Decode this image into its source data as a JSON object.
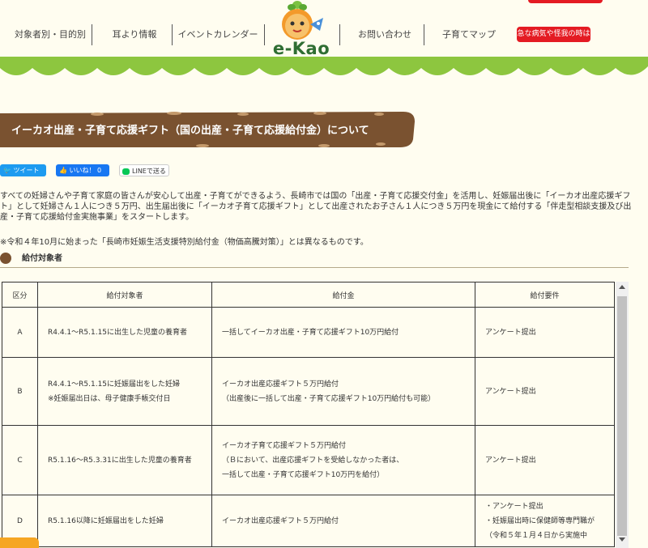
{
  "nav": {
    "items": [
      "対象者別・目的別",
      "耳より情報",
      "イベントカレンダー",
      "お問い合わせ",
      "子育てマップ"
    ],
    "emergency": "急な病気や怪我の時は"
  },
  "logo": {
    "text": "e-Kao"
  },
  "page": {
    "title": "イーカオ出産・子育て応援ギフト（国の出産・子育て応援給付金）について"
  },
  "share": {
    "tweet": "ツイート",
    "like": "いいね！ 0",
    "line": "LINEで送る"
  },
  "intro": "すべての妊婦さんや子育て家庭の皆さんが安心して出産・子育てができるよう、長崎市では国の「出産・子育て応援交付金」を活用し、妊娠届出後に「イーカオ出産応援ギフト」として妊婦さん１人につき５万円、出生届出後に「イーカオ子育て応援ギフト」として出産されたお子さん１人につき５万円を現金にて給付する「伴走型相談支援及び出産・子育て応援給付金実施事業」をスタートします。",
  "note": "※令和４年10月に始まった「長崎市妊娠生活支援特別給付金（物価高騰対策）」とは異なるものです。",
  "section": {
    "title": "給付対象者"
  },
  "table": {
    "headers": [
      "区分",
      "給付対象者",
      "給付金",
      "給付要件"
    ],
    "rows": [
      {
        "key": "A",
        "target": [
          "R4.4.1～R5.1.15に出生した児童の養育者"
        ],
        "amount": [
          "一括してイーカオ出産・子育て応援ギフト10万円給付"
        ],
        "req": [
          "アンケート提出"
        ]
      },
      {
        "key": "B",
        "target": [
          "R4.4.1～R5.1.15に妊娠届出をした妊婦",
          "※妊娠届出日は、母子健康手帳交付日"
        ],
        "amount": [
          "イーカオ出産応援ギフト５万円給付",
          "（出産後に一括して出産・子育て応援ギフト10万円給付も可能）"
        ],
        "req": [
          "アンケート提出"
        ]
      },
      {
        "key": "C",
        "target": [
          "R5.1.16～R5.3.31に出生した児童の養育者"
        ],
        "amount": [
          "イーカオ子育て応援ギフト５万円給付",
          "（Ｂにおいて、出産応援ギフトを受給しなかった者は、",
          "一括して出産・子育て応援ギフト10万円を給付）"
        ],
        "req": [
          "アンケート提出"
        ]
      },
      {
        "key": "D",
        "target": [
          "R5.1.16以降に妊娠届出をした妊婦"
        ],
        "amount": [
          "イーカオ出産応援ギフト５万円給付"
        ],
        "req": [
          "・アンケート提出",
          "・妊娠届出時に保健師等専門職が",
          "（令和５年１月４日から実施中"
        ]
      }
    ]
  },
  "colors": {
    "banner": "#7a5230",
    "accent_green": "#8dc63f",
    "emergency": "#e41b23",
    "bg": "#fffdf0"
  }
}
